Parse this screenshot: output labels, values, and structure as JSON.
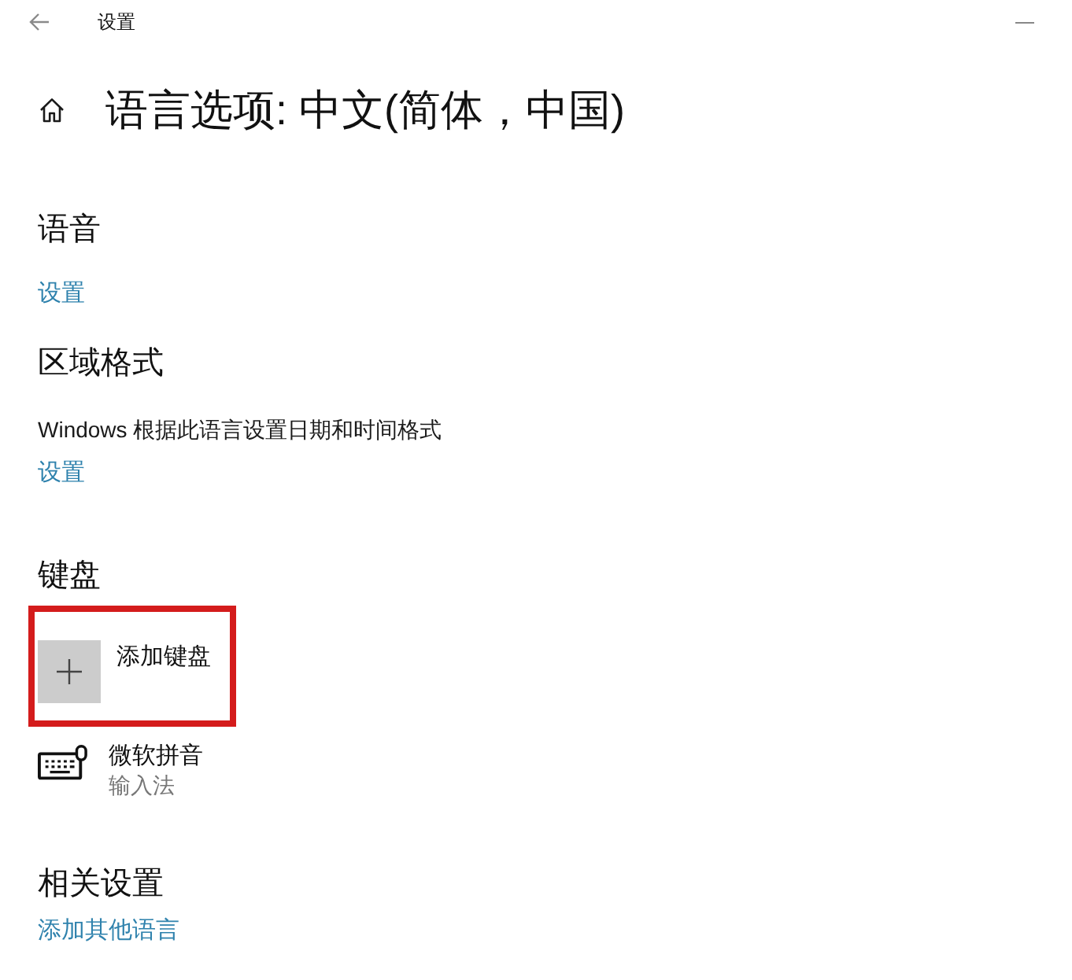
{
  "window": {
    "title": "设置"
  },
  "page": {
    "title": "语言选项: 中文(简体，中国)"
  },
  "sections": [
    {
      "heading": "语音",
      "items": [
        {
          "kind": "link",
          "label": "设置"
        }
      ]
    },
    {
      "heading": "区域格式",
      "items": [
        {
          "kind": "text",
          "label": "Windows 根据此语言设置日期和时间格式"
        },
        {
          "kind": "link",
          "label": "设置"
        }
      ]
    },
    {
      "heading": "键盘",
      "items": [
        {
          "kind": "add",
          "label": "添加键盘",
          "highlighted": true
        },
        {
          "kind": "entry",
          "label": "微软拼音",
          "sublabel": "输入法"
        }
      ]
    },
    {
      "heading": "相关设置",
      "items": [
        {
          "kind": "link",
          "label": "添加其他语言"
        }
      ]
    }
  ]
}
